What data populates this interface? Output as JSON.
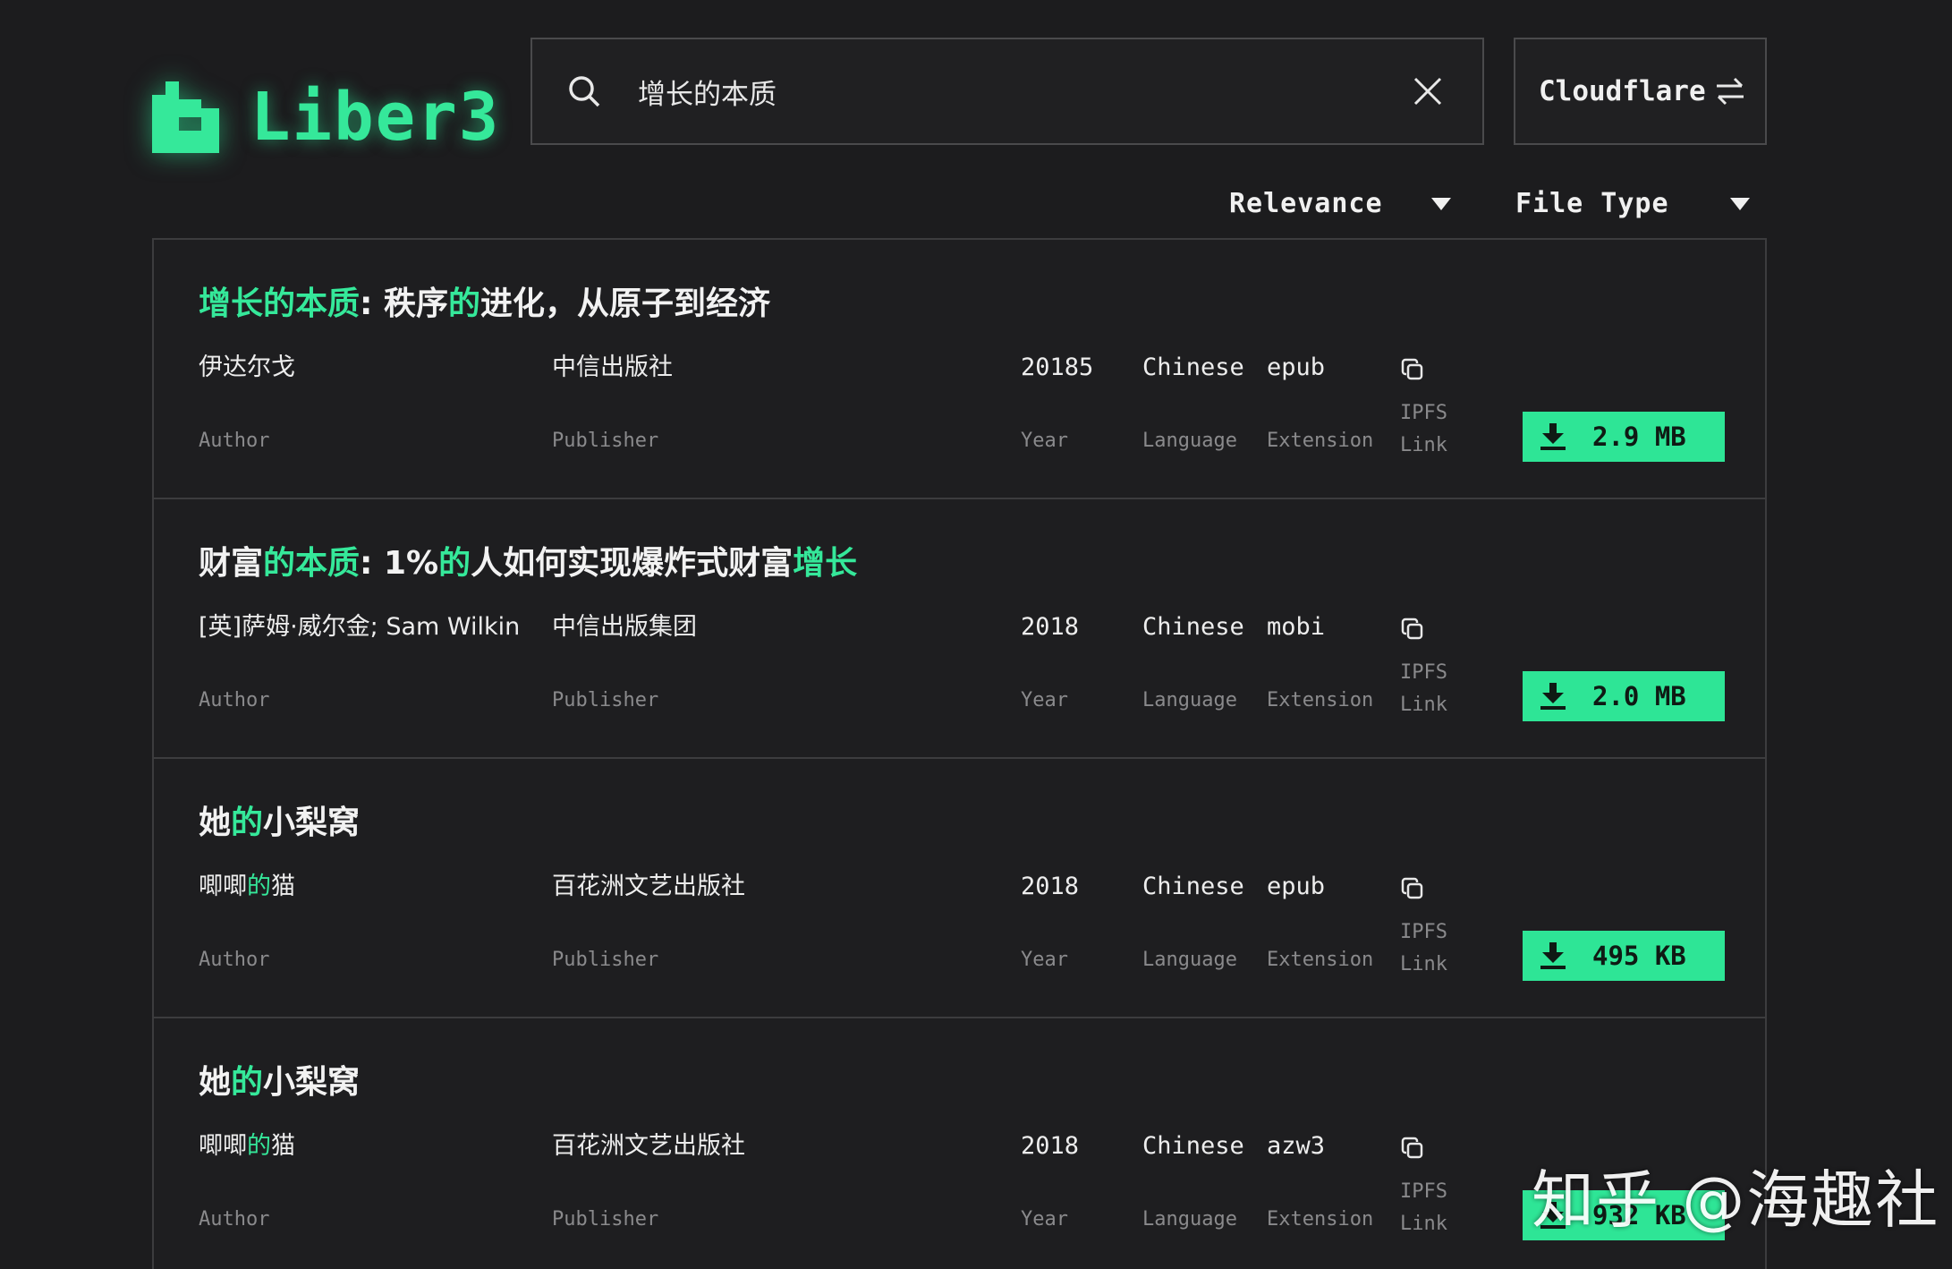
{
  "app": {
    "name": "Liber3",
    "accent_color": "#2ee596",
    "background_color": "#1c1c1e"
  },
  "search": {
    "value": "增长的本质",
    "icon": "search-icon",
    "clear_icon": "close-icon"
  },
  "gateway": {
    "label": "Cloudflare",
    "icon": "swap-arrows-icon"
  },
  "sort": {
    "order_label": "Relevance",
    "filetype_label": "File Type"
  },
  "labels": {
    "author": "Author",
    "publisher": "Publisher",
    "year": "Year",
    "language": "Language",
    "extension": "Extension",
    "ipfs_link": "IPFS Link"
  },
  "results": [
    {
      "title_parts": [
        {
          "text": "增长的本质",
          "hl": true
        },
        {
          "text": ": 秩序",
          "hl": false
        },
        {
          "text": "的",
          "hl": true
        },
        {
          "text": "进化，从原子到经济",
          "hl": false
        }
      ],
      "author_parts": [
        {
          "text": "伊达尔戈",
          "hl": false
        }
      ],
      "publisher": "中信出版社",
      "year": "20185",
      "language": "Chinese",
      "extension": "epub",
      "size": "2.9 MB"
    },
    {
      "title_parts": [
        {
          "text": "财富",
          "hl": false
        },
        {
          "text": "的本质",
          "hl": true
        },
        {
          "text": ": 1%",
          "hl": false
        },
        {
          "text": "的",
          "hl": true
        },
        {
          "text": "人如何实现爆炸式财富",
          "hl": false
        },
        {
          "text": "增长",
          "hl": true
        }
      ],
      "author_parts": [
        {
          "text": "[英]萨姆·威尔金; Sam Wilkin",
          "hl": false
        }
      ],
      "publisher": "中信出版集团",
      "year": "2018",
      "language": "Chinese",
      "extension": "mobi",
      "size": "2.0 MB"
    },
    {
      "title_parts": [
        {
          "text": "她",
          "hl": false
        },
        {
          "text": "的",
          "hl": true
        },
        {
          "text": "小梨窝",
          "hl": false
        }
      ],
      "author_parts": [
        {
          "text": "唧唧",
          "hl": false
        },
        {
          "text": "的",
          "hl": true
        },
        {
          "text": "猫",
          "hl": false
        }
      ],
      "publisher": "百花洲文艺出版社",
      "year": "2018",
      "language": "Chinese",
      "extension": "epub",
      "size": "495 KB"
    },
    {
      "title_parts": [
        {
          "text": "她",
          "hl": false
        },
        {
          "text": "的",
          "hl": true
        },
        {
          "text": "小梨窝",
          "hl": false
        }
      ],
      "author_parts": [
        {
          "text": "唧唧",
          "hl": false
        },
        {
          "text": "的",
          "hl": true
        },
        {
          "text": "猫",
          "hl": false
        }
      ],
      "publisher": "百花洲文艺出版社",
      "year": "2018",
      "language": "Chinese",
      "extension": "azw3",
      "size": "932 KB"
    }
  ],
  "watermark": "知乎 @海趣社"
}
